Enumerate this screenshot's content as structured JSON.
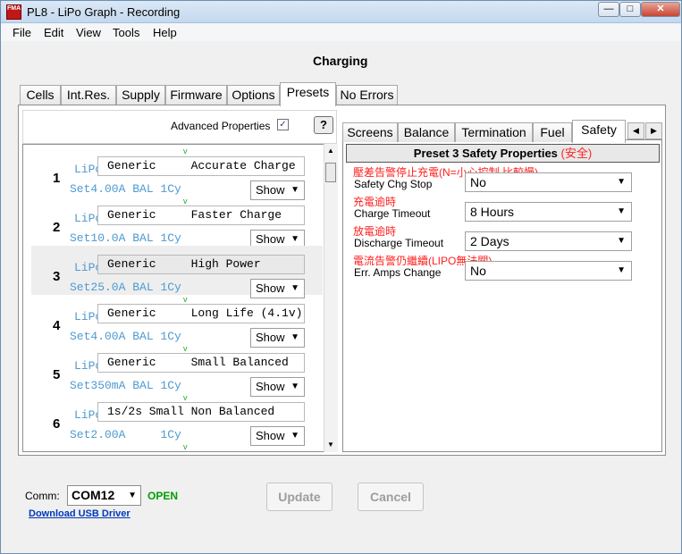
{
  "window": {
    "title": "PL8 - LiPo Graph - Recording",
    "app_icon_text": "FMA"
  },
  "menu": [
    "File",
    "Edit",
    "View",
    "Tools",
    "Help"
  ],
  "heading": "Charging",
  "tabs": [
    "Cells",
    "Int.Res.",
    "Supply",
    "Firmware",
    "Options",
    "Presets",
    "No Errors"
  ],
  "active_tab": "Presets",
  "advanced_properties": {
    "label": "Advanced Properties",
    "checked": "✓",
    "help_label": "?"
  },
  "presets": [
    {
      "number": "1",
      "chem": "LiPo",
      "name": "Generic     Accurate Charge",
      "detail": "Set4.00A BAL 1Cy",
      "show": "Show"
    },
    {
      "number": "2",
      "chem": "LiPo",
      "name": "Generic     Faster Charge",
      "detail": "Set10.0A BAL 1Cy",
      "show": "Show"
    },
    {
      "number": "3",
      "chem": "LiPo",
      "name": "Generic     High Power",
      "detail": "Set25.0A BAL 1Cy",
      "show": "Show"
    },
    {
      "number": "4",
      "chem": "LiPo",
      "name": "Generic     Long Life (4.1v)",
      "detail": "Set4.00A BAL 1Cy",
      "show": "Show"
    },
    {
      "number": "5",
      "chem": "LiPo",
      "name": "Generic     Small Balanced",
      "detail": "Set350mA BAL 1Cy",
      "show": "Show"
    },
    {
      "number": "6",
      "chem": "LiPo",
      "name": "1s/2s Small Non Balanced",
      "detail": "Set2.00A     1Cy",
      "show": "Show"
    }
  ],
  "right_tabs": [
    "Screens",
    "Balance",
    "Termination",
    "Fuel",
    "Safety"
  ],
  "active_right_tab": "Safety",
  "safety": {
    "header": "Preset 3  Safety Properties",
    "header_cn": "(安全)",
    "notes": [
      "壓差告警停止充電(N=小心控制,比較慢)",
      "充電逾時",
      "放電逾時",
      "電流告警仍繼續(LIPO無法關)"
    ],
    "properties": [
      {
        "label": "Safety Chg Stop",
        "value": "No"
      },
      {
        "label": "Charge Timeout",
        "value": "8 Hours"
      },
      {
        "label": "Discharge Timeout",
        "value": "2 Days"
      },
      {
        "label": "Err. Amps Change",
        "value": "No"
      }
    ]
  },
  "footer": {
    "comm_label": "Comm:",
    "comm_value": "COM12",
    "status": "OPEN",
    "usb_link": "Download USB Driver",
    "update_label": "Update",
    "cancel_label": "Cancel"
  },
  "colors": {
    "accent": "#4e9ad0",
    "status_open": "#00a000",
    "note_red": "#ff1f1f"
  }
}
